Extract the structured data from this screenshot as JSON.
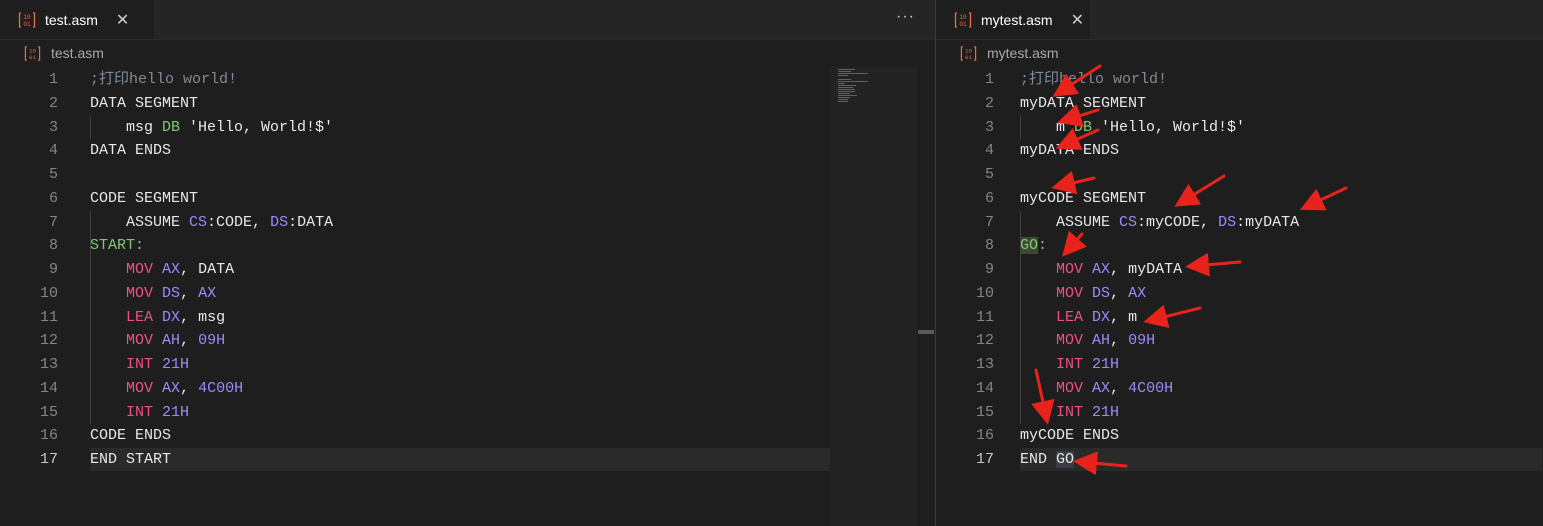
{
  "left": {
    "tab": {
      "label": "test.asm",
      "close": "✕"
    },
    "more": "···",
    "breadcrumb": "test.asm",
    "lines": [
      {
        "n": "1",
        "t": [
          [
            "c-cmt2",
            ";打印hello world!"
          ]
        ]
      },
      {
        "n": "2",
        "t": [
          [
            "c-dir",
            "DATA SEGMENT"
          ]
        ]
      },
      {
        "n": "3",
        "t": [
          [
            "c-pl",
            "    msg "
          ],
          [
            "c-db",
            "DB"
          ],
          [
            "c-str",
            " 'Hello, World!$'"
          ]
        ]
      },
      {
        "n": "4",
        "t": [
          [
            "c-dir",
            "DATA ENDS"
          ]
        ]
      },
      {
        "n": "5",
        "t": []
      },
      {
        "n": "6",
        "t": [
          [
            "c-dir",
            "CODE SEGMENT"
          ]
        ]
      },
      {
        "n": "7",
        "t": [
          [
            "c-pl",
            "    ASSUME "
          ],
          [
            "c-reg",
            "CS"
          ],
          [
            "c-pl",
            ":CODE, "
          ],
          [
            "c-reg",
            "DS"
          ],
          [
            "c-pl",
            ":DATA"
          ]
        ]
      },
      {
        "n": "8",
        "t": [
          [
            "c-lbl",
            "START:"
          ]
        ]
      },
      {
        "n": "9",
        "t": [
          [
            "c-pl",
            "    "
          ],
          [
            "c-ins",
            "MOV"
          ],
          [
            "c-pl",
            " "
          ],
          [
            "c-reg",
            "AX"
          ],
          [
            "c-pl",
            ", DATA"
          ]
        ]
      },
      {
        "n": "10",
        "t": [
          [
            "c-pl",
            "    "
          ],
          [
            "c-ins",
            "MOV"
          ],
          [
            "c-pl",
            " "
          ],
          [
            "c-reg",
            "DS"
          ],
          [
            "c-pl",
            ", "
          ],
          [
            "c-reg",
            "AX"
          ]
        ]
      },
      {
        "n": "11",
        "t": [
          [
            "c-pl",
            "    "
          ],
          [
            "c-ins",
            "LEA"
          ],
          [
            "c-pl",
            " "
          ],
          [
            "c-reg",
            "DX"
          ],
          [
            "c-pl",
            ", msg"
          ]
        ]
      },
      {
        "n": "12",
        "t": [
          [
            "c-pl",
            "    "
          ],
          [
            "c-ins",
            "MOV"
          ],
          [
            "c-pl",
            " "
          ],
          [
            "c-reg",
            "AH"
          ],
          [
            "c-pl",
            ", "
          ],
          [
            "c-num",
            "09H"
          ]
        ]
      },
      {
        "n": "13",
        "t": [
          [
            "c-pl",
            "    "
          ],
          [
            "c-ins",
            "INT"
          ],
          [
            "c-pl",
            " "
          ],
          [
            "c-num",
            "21H"
          ]
        ]
      },
      {
        "n": "14",
        "t": [
          [
            "c-pl",
            "    "
          ],
          [
            "c-ins",
            "MOV"
          ],
          [
            "c-pl",
            " "
          ],
          [
            "c-reg",
            "AX"
          ],
          [
            "c-pl",
            ", "
          ],
          [
            "c-num",
            "4C00H"
          ]
        ]
      },
      {
        "n": "15",
        "t": [
          [
            "c-pl",
            "    "
          ],
          [
            "c-ins",
            "INT"
          ],
          [
            "c-pl",
            " "
          ],
          [
            "c-num",
            "21H"
          ]
        ]
      },
      {
        "n": "16",
        "t": [
          [
            "c-dir",
            "CODE ENDS"
          ]
        ]
      },
      {
        "n": "17",
        "t": [
          [
            "c-dir",
            "END START"
          ]
        ]
      }
    ]
  },
  "right": {
    "tab": {
      "label": "mytest.asm",
      "close": "✕"
    },
    "breadcrumb": "mytest.asm",
    "lines": [
      {
        "n": "1",
        "t": [
          [
            "c-cmt2",
            ";打印hello world!"
          ]
        ]
      },
      {
        "n": "2",
        "t": [
          [
            "c-dir",
            "myDATA SEGMENT"
          ]
        ]
      },
      {
        "n": "3",
        "t": [
          [
            "c-pl",
            "    m "
          ],
          [
            "c-db",
            "DB"
          ],
          [
            "c-str",
            " 'Hello, World!$'"
          ]
        ]
      },
      {
        "n": "4",
        "t": [
          [
            "c-dir",
            "myDATA ENDS"
          ]
        ]
      },
      {
        "n": "5",
        "t": []
      },
      {
        "n": "6",
        "t": [
          [
            "c-dir",
            "myCODE SEGMENT"
          ]
        ]
      },
      {
        "n": "7",
        "t": [
          [
            "c-pl",
            "    ASSUME "
          ],
          [
            "c-reg",
            "CS"
          ],
          [
            "c-pl",
            ":myCODE, "
          ],
          [
            "c-reg",
            "DS"
          ],
          [
            "c-pl",
            ":myDATA"
          ]
        ]
      },
      {
        "n": "8",
        "t": [
          [
            "c-lbl sel-go",
            "GO"
          ],
          [
            "c-lbl",
            ":"
          ]
        ]
      },
      {
        "n": "9",
        "t": [
          [
            "c-pl",
            "    "
          ],
          [
            "c-ins",
            "MOV"
          ],
          [
            "c-pl",
            " "
          ],
          [
            "c-reg",
            "AX"
          ],
          [
            "c-pl",
            ", myDATA"
          ]
        ]
      },
      {
        "n": "10",
        "t": [
          [
            "c-pl",
            "    "
          ],
          [
            "c-ins",
            "MOV"
          ],
          [
            "c-pl",
            " "
          ],
          [
            "c-reg",
            "DS"
          ],
          [
            "c-pl",
            ", "
          ],
          [
            "c-reg",
            "AX"
          ]
        ]
      },
      {
        "n": "11",
        "t": [
          [
            "c-pl",
            "    "
          ],
          [
            "c-ins",
            "LEA"
          ],
          [
            "c-pl",
            " "
          ],
          [
            "c-reg",
            "DX"
          ],
          [
            "c-pl",
            ", m"
          ]
        ]
      },
      {
        "n": "12",
        "t": [
          [
            "c-pl",
            "    "
          ],
          [
            "c-ins",
            "MOV"
          ],
          [
            "c-pl",
            " "
          ],
          [
            "c-reg",
            "AH"
          ],
          [
            "c-pl",
            ", "
          ],
          [
            "c-num",
            "09H"
          ]
        ]
      },
      {
        "n": "13",
        "t": [
          [
            "c-pl",
            "    "
          ],
          [
            "c-ins",
            "INT"
          ],
          [
            "c-pl",
            " "
          ],
          [
            "c-num",
            "21H"
          ]
        ]
      },
      {
        "n": "14",
        "t": [
          [
            "c-pl",
            "    "
          ],
          [
            "c-ins",
            "MOV"
          ],
          [
            "c-pl",
            " "
          ],
          [
            "c-reg",
            "AX"
          ],
          [
            "c-pl",
            ", "
          ],
          [
            "c-num",
            "4C00H"
          ]
        ]
      },
      {
        "n": "15",
        "t": [
          [
            "c-pl",
            "    "
          ],
          [
            "c-ins",
            "INT"
          ],
          [
            "c-pl",
            " "
          ],
          [
            "c-num",
            "21H"
          ]
        ]
      },
      {
        "n": "16",
        "t": [
          [
            "c-dir",
            "myCODE ENDS"
          ]
        ]
      },
      {
        "n": "17",
        "t": [
          [
            "c-dir",
            "END "
          ],
          [
            "c-dir sel-go2",
            "GO"
          ]
        ]
      }
    ]
  },
  "active_line": "17",
  "colors": {
    "arrow": "#e8231c",
    "file_icon": "#e07040"
  },
  "icons": {
    "file": "asm-file-icon",
    "close": "close-icon",
    "more": "more-actions-icon",
    "arrow": "red-arrow-annotation"
  }
}
